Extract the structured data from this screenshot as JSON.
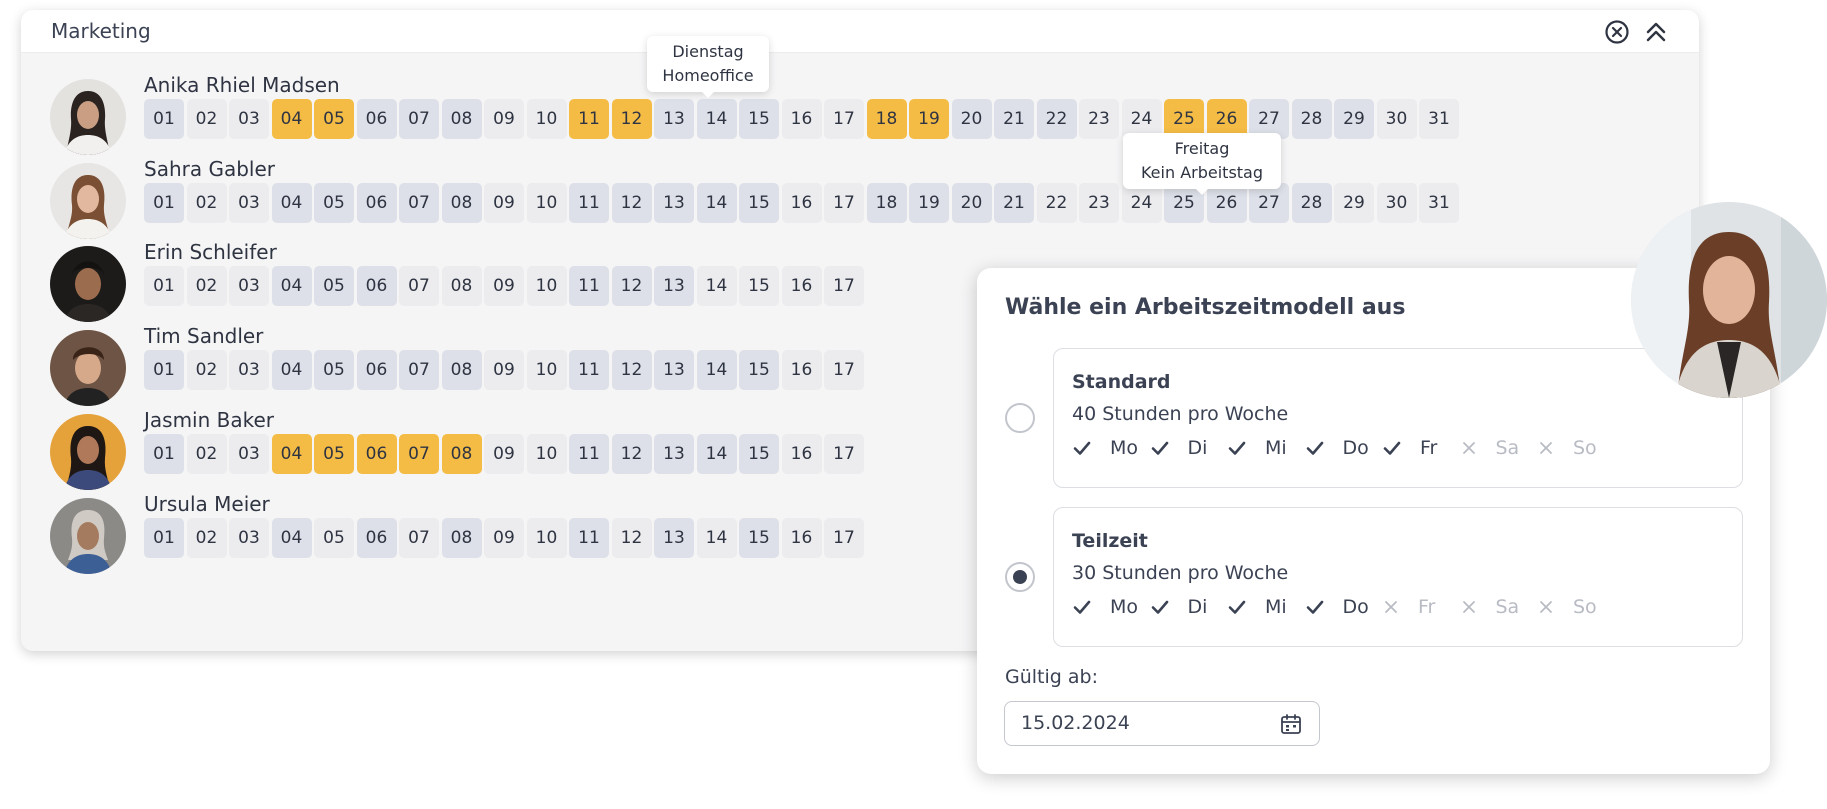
{
  "card": {
    "title": "Marketing",
    "close_icon": "close-circle-icon",
    "collapse_icon": "double-chevron-up-icon"
  },
  "employees": [
    {
      "name": "Anika Rhiel Madsen",
      "highlight": [
        4,
        5,
        11,
        12,
        18,
        19,
        25,
        26
      ],
      "weekend": [
        1,
        6,
        7,
        8,
        13,
        14,
        15,
        20,
        21,
        22,
        27,
        28,
        29
      ]
    },
    {
      "name": "Sahra Gabler",
      "highlight": [],
      "weekend": [
        1,
        4,
        5,
        6,
        7,
        8,
        11,
        12,
        13,
        14,
        15,
        18,
        19,
        20,
        21,
        25,
        26,
        27,
        28
      ]
    },
    {
      "name": "Erin Schleifer",
      "highlight": [],
      "weekend": [
        4,
        5,
        6,
        11,
        12,
        13
      ]
    },
    {
      "name": "Tim Sandler",
      "highlight": [],
      "weekend": [
        1,
        4,
        5,
        6,
        7,
        8,
        11,
        12,
        13,
        14,
        15
      ]
    },
    {
      "name": "Jasmin Baker",
      "highlight": [
        4,
        5,
        6,
        7,
        8
      ],
      "weekend": [
        1,
        11,
        12,
        13,
        14,
        15
      ]
    },
    {
      "name": "Ursula Meier",
      "highlight": [],
      "weekend": [
        1,
        4,
        6,
        8,
        11,
        13,
        15
      ]
    }
  ],
  "days": {
    "row1": [
      "01",
      "02",
      "03",
      "04",
      "05",
      "06",
      "07",
      "08",
      "09",
      "10",
      "11",
      "12",
      "13",
      "14",
      "15",
      "16",
      "17",
      "18",
      "19",
      "20",
      "21",
      "22",
      "23",
      "24",
      "25",
      "26",
      "27",
      "28",
      "29",
      "30",
      "31"
    ],
    "row2": [
      "01",
      "02",
      "03",
      "04",
      "05",
      "06",
      "07",
      "08",
      "09",
      "10",
      "11",
      "12",
      "13",
      "14",
      "15",
      "16",
      "17",
      "18",
      "19",
      "20",
      "21",
      "22",
      "23",
      "24",
      "25",
      "26",
      "27",
      "28",
      "29",
      "30",
      "31"
    ],
    "row3": [
      "01",
      "02",
      "03",
      "04",
      "05",
      "06",
      "07",
      "08",
      "09",
      "10",
      "11",
      "12",
      "13",
      "14",
      "15",
      "16",
      "17"
    ],
    "row4": [
      "01",
      "02",
      "03",
      "04",
      "05",
      "06",
      "07",
      "08",
      "09",
      "10",
      "11",
      "12",
      "13",
      "14",
      "15",
      "16",
      "17"
    ],
    "row5": [
      "01",
      "02",
      "03",
      "04",
      "05",
      "06",
      "07",
      "08",
      "09",
      "10",
      "11",
      "12",
      "13",
      "14",
      "15",
      "16",
      "17"
    ],
    "row6": [
      "01",
      "02",
      "03",
      "04",
      "05",
      "06",
      "07",
      "08",
      "09",
      "10",
      "11",
      "12",
      "13",
      "14",
      "15",
      "16",
      "17"
    ]
  },
  "tooltips": {
    "t1": {
      "line1": "Dienstag",
      "line2": "Homeoffice"
    },
    "t2": {
      "line1": "Freitag",
      "line2": "Kein Arbeitstag"
    }
  },
  "modal": {
    "title": "Wähle ein Arbeitszeitmodell aus",
    "options": [
      {
        "title": "Standard",
        "hours": "40 Stunden pro Woche",
        "selected": false,
        "days": [
          {
            "label": "Mo",
            "on": true
          },
          {
            "label": "Di",
            "on": true
          },
          {
            "label": "Mi",
            "on": true
          },
          {
            "label": "Do",
            "on": true
          },
          {
            "label": "Fr",
            "on": true
          },
          {
            "label": "Sa",
            "on": false
          },
          {
            "label": "So",
            "on": false
          }
        ]
      },
      {
        "title": "Teilzeit",
        "hours": "30 Stunden pro Woche",
        "selected": true,
        "days": [
          {
            "label": "Mo",
            "on": true
          },
          {
            "label": "Di",
            "on": true
          },
          {
            "label": "Mi",
            "on": true
          },
          {
            "label": "Do",
            "on": true
          },
          {
            "label": "Fr",
            "on": false
          },
          {
            "label": "Sa",
            "on": false
          },
          {
            "label": "So",
            "on": false
          }
        ]
      }
    ],
    "valid_from_label": "Gültig ab:",
    "valid_from_value": "15.02.2024",
    "calendar_icon": "calendar-icon"
  },
  "colors": {
    "highlight": "#f4bc45",
    "weekend": "#dde0e8",
    "workday": "#ececef",
    "text": "#3b4253"
  }
}
